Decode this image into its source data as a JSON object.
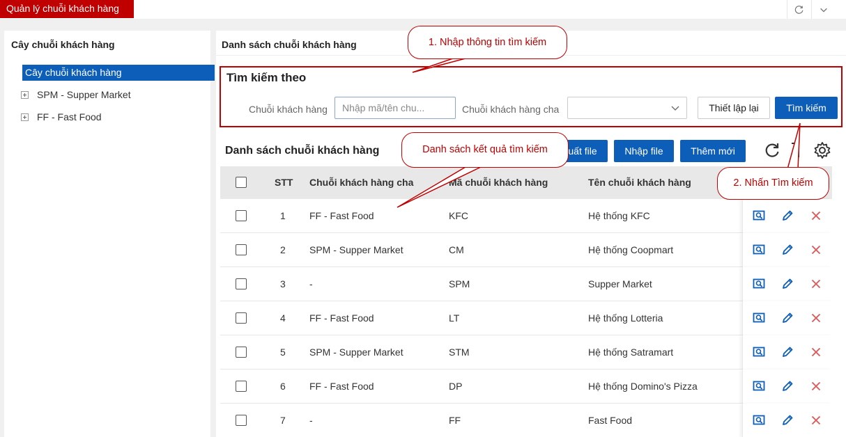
{
  "app": {
    "tab_title": "Quản lý chuỗi khách hàng",
    "refresh_icon": "refresh-icon",
    "collapse_icon": "chevron-down-icon"
  },
  "left": {
    "title": "Cây chuỗi khách hàng",
    "root": "Cây chuỗi khách hàng",
    "nodes": [
      "SPM - Supper Market",
      "FF - Fast Food"
    ]
  },
  "right": {
    "title": "Danh sách chuỗi khách hàng"
  },
  "search": {
    "heading": "Tìm kiếm theo",
    "chain_label": "Chuỗi khách hàng",
    "chain_placeholder": "Nhập mã/tên chu...",
    "parent_label": "Chuỗi khách hàng cha",
    "parent_value": "",
    "reset_label": "Thiết lập lại",
    "search_label": "Tìm kiếm"
  },
  "list": {
    "heading": "Danh sách chuỗi khách hàng",
    "export_label": "uất file",
    "import_label": "Nhập file",
    "add_label": "Thêm mới"
  },
  "table": {
    "headers": {
      "stt": "STT",
      "parent": "Chuỗi khách hàng cha",
      "code": "Mã chuỗi khách hàng",
      "name": "Tên chuỗi khách hàng"
    },
    "rows": [
      {
        "stt": "1",
        "parent": "FF - Fast Food",
        "code": "KFC",
        "name": "Hệ thống KFC"
      },
      {
        "stt": "2",
        "parent": "SPM - Supper Market",
        "code": "CM",
        "name": "Hệ thống Coopmart"
      },
      {
        "stt": "3",
        "parent": "-",
        "code": "SPM",
        "name": "Supper Market"
      },
      {
        "stt": "4",
        "parent": "FF - Fast Food",
        "code": "LT",
        "name": "Hệ thống Lotteria"
      },
      {
        "stt": "5",
        "parent": "SPM - Supper Market",
        "code": "STM",
        "name": "Hệ thống Satramart"
      },
      {
        "stt": "6",
        "parent": "FF - Fast Food",
        "code": "DP",
        "name": "Hệ thống Domino's Pizza"
      },
      {
        "stt": "7",
        "parent": "-",
        "code": "FF",
        "name": "Fast Food"
      }
    ]
  },
  "callouts": {
    "step1": "1. Nhập thông tin tìm kiếm",
    "results": "Danh sách kết quả tìm kiếm",
    "step2": "2. Nhấn Tìm kiếm"
  },
  "colors": {
    "brand_red": "#c00000",
    "primary_blue": "#0d5eb8",
    "delete_red": "#e05555"
  }
}
